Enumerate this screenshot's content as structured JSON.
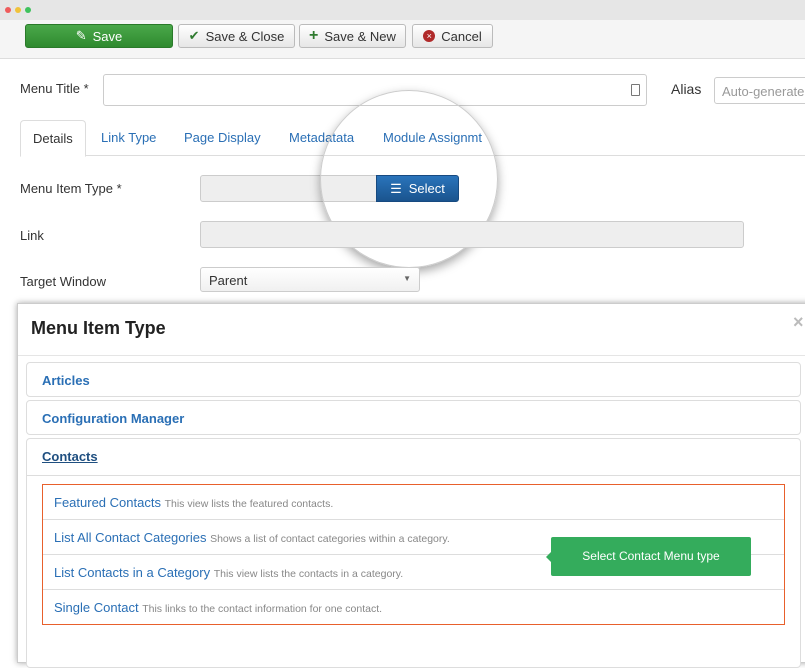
{
  "window": {
    "dots": [
      "#ef5b5b",
      "#f0c23b",
      "#3fc25d"
    ]
  },
  "toolbar": {
    "save": "Save",
    "save_close": "Save & Close",
    "save_new": "Save & New",
    "cancel": "Cancel"
  },
  "form": {
    "menu_title_label": "Menu Title *",
    "menu_title_value": "",
    "alias_label": "Alias",
    "alias_placeholder": "Auto-generate",
    "menu_item_type_label": "Menu Item Type *",
    "select_button": "Select",
    "link_label": "Link",
    "target_window_label": "Target Window",
    "target_window_value": "Parent"
  },
  "tabs": [
    "Details",
    "Link Type",
    "Page Display",
    "Metadatata",
    "Module Assignmt"
  ],
  "modal": {
    "title": "Menu Item Type",
    "close": "×",
    "groups": [
      "Articles",
      "Configuration Manager",
      "Contacts"
    ],
    "items": [
      {
        "title": "Featured Contacts",
        "desc": "This view lists the featured contacts."
      },
      {
        "title": "List All Contact Categories",
        "desc": "Shows a list of contact categories within a category."
      },
      {
        "title": "List Contacts in a Category",
        "desc": "This view lists the contacts in a category."
      },
      {
        "title": "Single Contact",
        "desc": "This links to the contact information for one contact."
      }
    ],
    "tooltip": "Select Contact Menu type"
  },
  "colors": {
    "save_green": "#3a9a3a",
    "select_blue": "#1f5f9e",
    "highlight": "#e8602c",
    "tooltip": "#34ac5c",
    "link": "#2a6fb5"
  }
}
